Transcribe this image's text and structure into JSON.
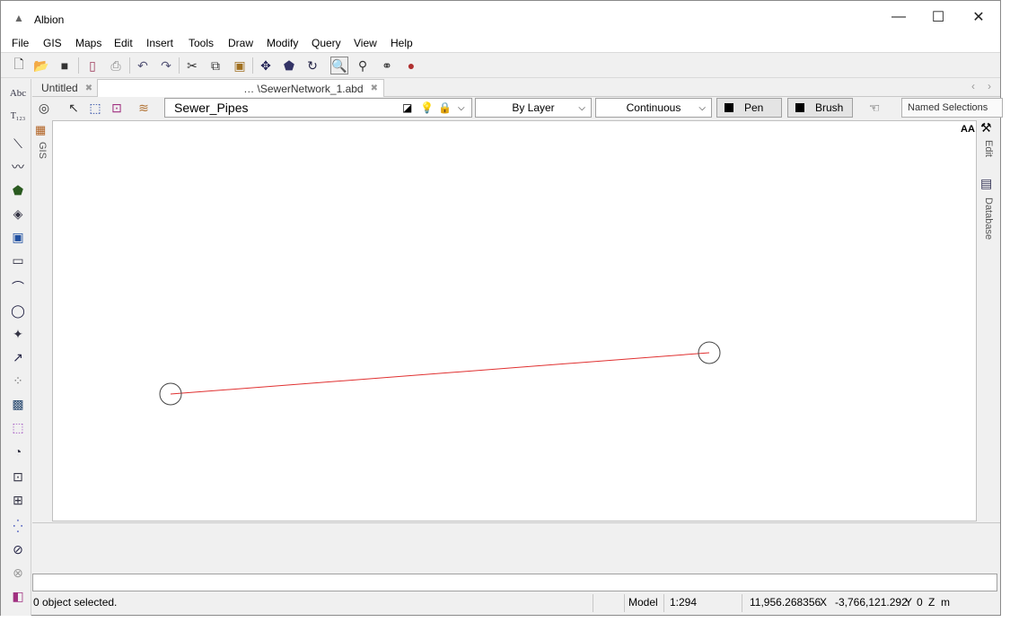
{
  "window": {
    "title": "Albion",
    "minimize": "—",
    "maximize": "☐",
    "close": "✕"
  },
  "menu": [
    "File",
    "GIS",
    "Maps",
    "Edit",
    "Insert",
    "Tools",
    "Draw",
    "Modify",
    "Query",
    "View",
    "Help"
  ],
  "tabs": [
    {
      "label": "Untitled",
      "close": "✖"
    },
    {
      "label": "… \\SewerNetwork_1.abd",
      "close": "✖"
    }
  ],
  "layer_bar": {
    "layer_name": "Sewer_Pipes",
    "color": "By Layer",
    "linetype": "Continuous",
    "pen_label": "Pen",
    "brush_label": "Brush",
    "named_selections": "Named Selections"
  },
  "left_strip": {
    "gis_label": "GIS"
  },
  "right_strip": {
    "edit_label": "Edit",
    "database_label": "Database",
    "font_toggle": "AA"
  },
  "drawing": {
    "line_color": "#e03030"
  },
  "status": {
    "selection": "0 object selected.",
    "space": "Model",
    "scale": "1:294",
    "x_value": "11,956.268356",
    "x_label": "X",
    "y_value": "-3,766,121.292",
    "y_label": "Y",
    "z_value": "0",
    "z_label": "Z",
    "units": "m"
  }
}
